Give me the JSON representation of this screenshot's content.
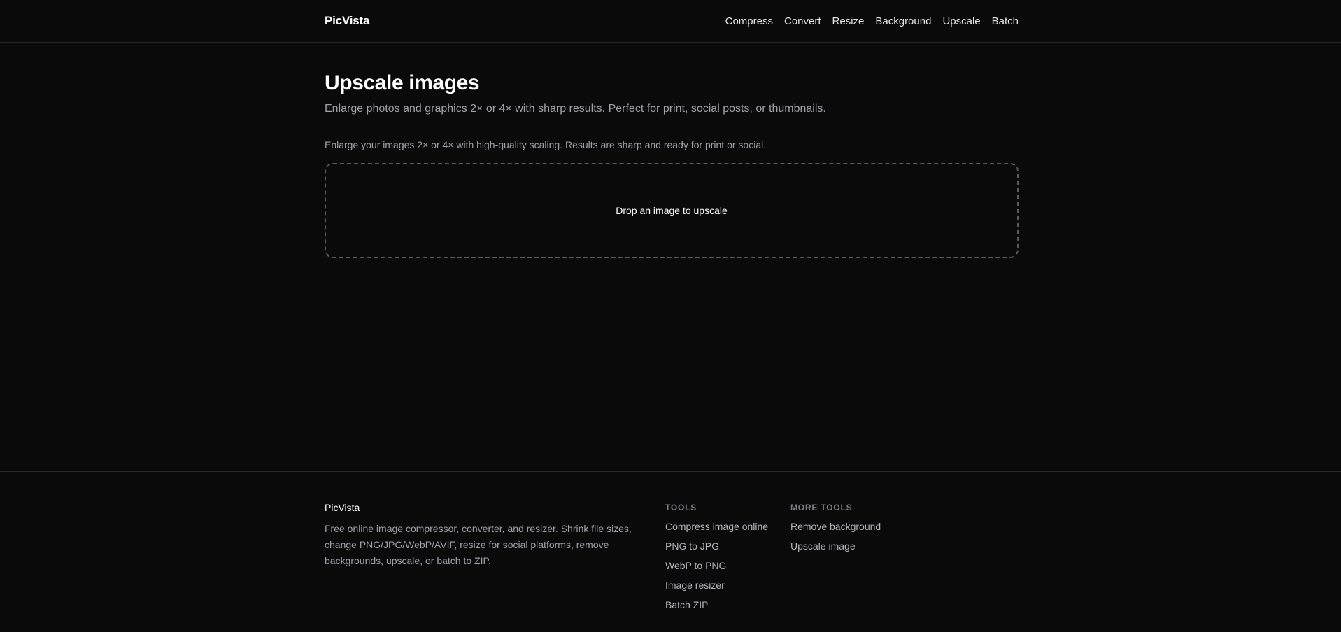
{
  "header": {
    "logo": "PicVista",
    "nav": [
      "Compress",
      "Convert",
      "Resize",
      "Background",
      "Upscale",
      "Batch"
    ]
  },
  "main": {
    "title": "Upscale images",
    "subtitle": "Enlarge photos and graphics 2× or 4× with sharp results. Perfect for print, social posts, or thumbnails.",
    "intro": "Enlarge your images 2× or 4× with high-quality scaling. Results are sharp and ready for print or social.",
    "dropzone_label": "Drop an image to upscale"
  },
  "footer": {
    "brand_name": "PicVista",
    "brand_desc": "Free online image compressor, converter, and resizer. Shrink file sizes, change PNG/JPG/WebP/AVIF, resize for social platforms, remove backgrounds, upscale, or batch to ZIP.",
    "tools_heading": "TOOLS",
    "tools": [
      "Compress image online",
      "PNG to JPG",
      "WebP to PNG",
      "Image resizer",
      "Batch ZIP"
    ],
    "more_heading": "MORE TOOLS",
    "more_tools": [
      "Remove background",
      "Upscale image"
    ]
  },
  "colors": {
    "background": "#0a0a0b",
    "text": "#ffffff",
    "muted": "#a1a1aa",
    "border": "#26272b"
  }
}
